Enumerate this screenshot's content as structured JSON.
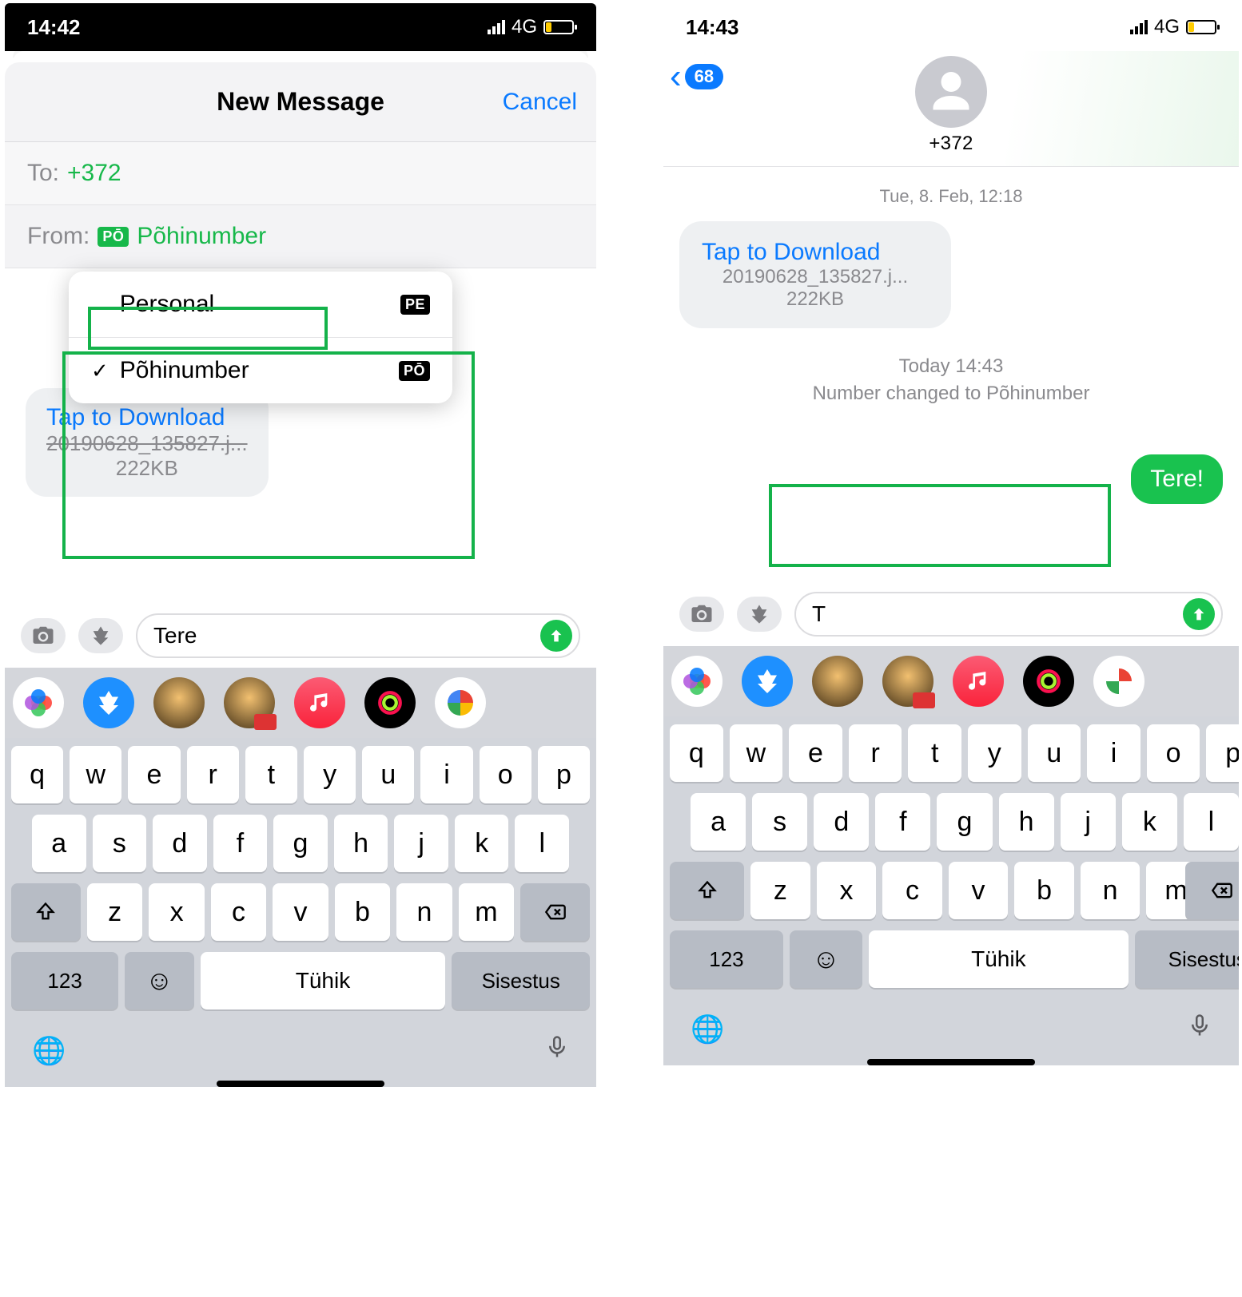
{
  "phone1": {
    "status": {
      "time": "14:42",
      "net": "4G"
    },
    "modal": {
      "title": "New Message",
      "cancel": "Cancel"
    },
    "to": {
      "label": "To:",
      "value": "+372"
    },
    "from": {
      "label": "From:",
      "badge": "PŌ",
      "value": "Põhinumber"
    },
    "sim_options": [
      {
        "label": "Personal",
        "code": "PE",
        "selected": false
      },
      {
        "label": "Põhinumber",
        "code": "PŌ",
        "selected": true
      }
    ],
    "download": {
      "tap": "Tap to Download",
      "file": "20190628_135827.j...",
      "size": "222KB"
    },
    "compose_value": "Tere"
  },
  "phone2": {
    "status": {
      "time": "14:43",
      "net": "4G"
    },
    "back_badge": "68",
    "contact": "+372",
    "thread_date": "Tue, 8. Feb, 12:18",
    "download": {
      "tap": "Tap to Download",
      "file": "20190628_135827.j...",
      "size": "222KB"
    },
    "sys": {
      "time": "Today 14:43",
      "text": "Number changed to Põhinumber"
    },
    "out_msg": "Tere!",
    "compose_value": "T"
  },
  "keyboard": {
    "row1": [
      "q",
      "w",
      "e",
      "r",
      "t",
      "y",
      "u",
      "i",
      "o",
      "p"
    ],
    "row2": [
      "a",
      "s",
      "d",
      "f",
      "g",
      "h",
      "j",
      "k",
      "l"
    ],
    "row3": [
      "z",
      "x",
      "c",
      "v",
      "b",
      "n",
      "m"
    ],
    "numkey": "123",
    "space": "Tühik",
    "enter": "Sisestus"
  }
}
